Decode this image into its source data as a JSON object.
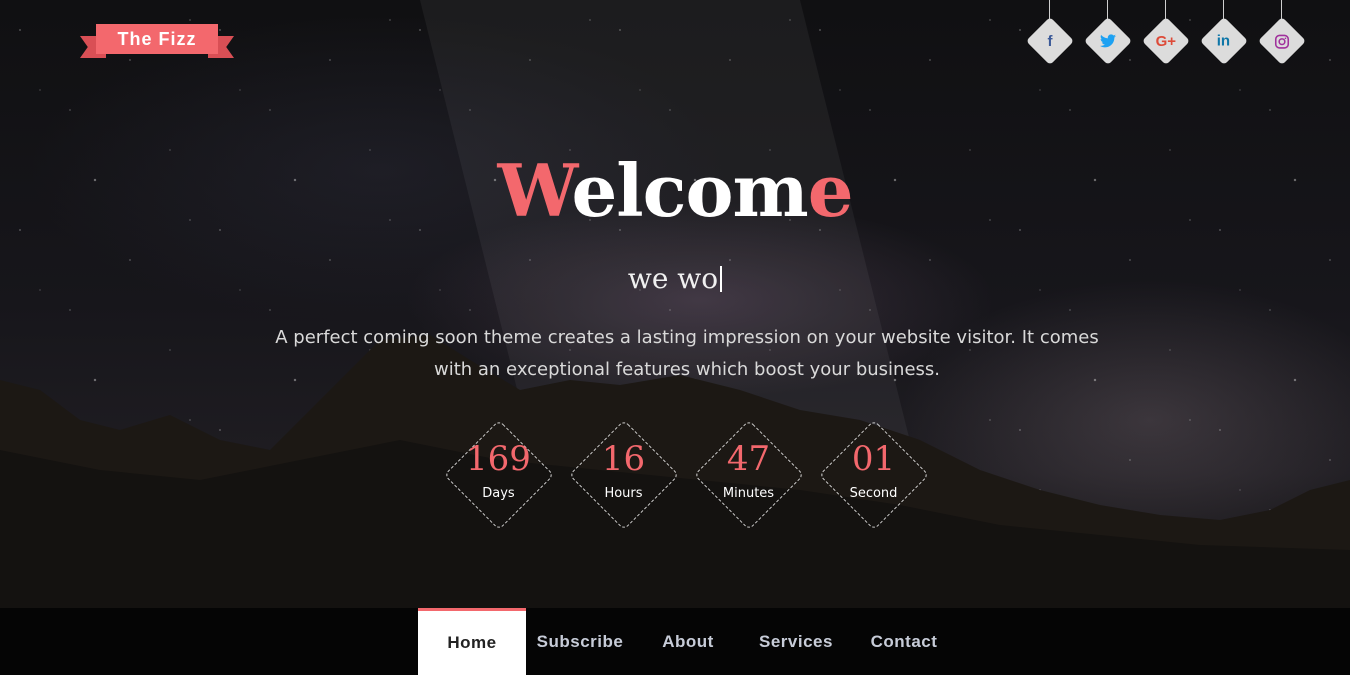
{
  "brand": {
    "name": "The Fizz",
    "accent_color": "#f3686d"
  },
  "social_links": [
    {
      "name": "facebook",
      "glyph": "f",
      "color": "#3b5998"
    },
    {
      "name": "twitter",
      "glyph": "🐦",
      "color": "#1da1f2"
    },
    {
      "name": "google-plus",
      "glyph": "G+",
      "color": "#dd4b39"
    },
    {
      "name": "linkedin",
      "glyph": "in",
      "color": "#0e76a8"
    },
    {
      "name": "instagram",
      "glyph": "◎",
      "color": "#a0319c"
    }
  ],
  "hero": {
    "title_parts": [
      "W",
      "elco",
      "m",
      "e"
    ],
    "typed_text": "we wo",
    "description_line1": "A perfect coming soon theme creates a lasting impression on your website visitor. It comes",
    "description_line2": "with an exceptional features which boost your business."
  },
  "countdown": [
    {
      "value": "169",
      "label": "Days"
    },
    {
      "value": "16",
      "label": "Hours"
    },
    {
      "value": "47",
      "label": "Minutes"
    },
    {
      "value": "01",
      "label": "Second"
    }
  ],
  "nav": {
    "items": [
      "Home",
      "Subscribe",
      "About",
      "Services",
      "Contact"
    ],
    "active": "Home"
  }
}
